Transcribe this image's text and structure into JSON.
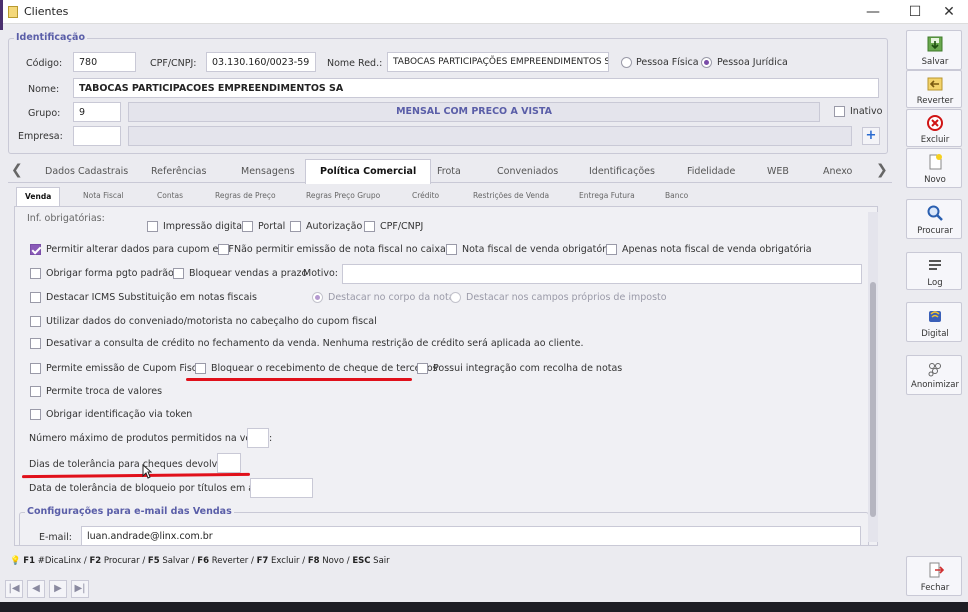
{
  "window": {
    "title": "Clientes",
    "minimize": "—",
    "maximize": "☐",
    "close": "✕"
  },
  "identificacao": {
    "title": "Identificação",
    "codigo_label": "Código:",
    "codigo": "780",
    "cpf_label": "CPF/CNPJ:",
    "cpf": "03.130.160/0023-59",
    "nome_red_label": "Nome Red.:",
    "nome_red": "TABOCAS PARTICIPAÇÕES EMPREENDIMENTOS S/A",
    "pessoa_fisica": "Pessoa Física",
    "pessoa_juridica": "Pessoa Jurídica",
    "nome_label": "Nome:",
    "nome": "TABOCAS PARTICIPACOES EMPREENDIMENTOS SA",
    "grupo_label": "Grupo:",
    "grupo": "9",
    "grupo_desc": "MENSAL COM PRECO A VISTA",
    "inativo": "Inativo",
    "empresa_label": "Empresa:",
    "empresa": "",
    "add": "+"
  },
  "tabs": [
    "Dados Cadastrais",
    "Referências",
    "Mensagens",
    "Política Comercial",
    "Frota",
    "Conveniados",
    "Identificações",
    "Fidelidade",
    "WEB",
    "Anexo"
  ],
  "tab_arrows": {
    "left": "❮",
    "right": "❯"
  },
  "subtabs": [
    "Venda",
    "Nota Fiscal",
    "Contas",
    "Regras de Preço",
    "Regras Preço Grupo",
    "Crédito",
    "Restrições de Venda",
    "Entrega Futura",
    "Banco"
  ],
  "venda": {
    "inf_obrigatorias": "Inf. obrigatórias:",
    "impressao_digital": "Impressão digital",
    "portal": "Portal",
    "autorizacao": "Autorização",
    "cpf_cnpj": "CPF/CNPJ",
    "permitir_alterar": "Permitir alterar dados para cupom e NF",
    "nao_permitir_emissao": "Não permitir emissão de nota fiscal no caixa",
    "nota_fiscal_obrigatoria": "Nota fiscal de venda obrigatória",
    "apenas_nota_fiscal": "Apenas nota fiscal de venda obrigatória",
    "obrigar_forma_pgto": "Obrigar forma pgto padrão",
    "bloquear_vendas_prazo": "Bloquear vendas a prazo",
    "motivo_label": "Motivo:",
    "motivo": "",
    "destacar_icms": "Destacar ICMS Substituição em notas fiscais",
    "destacar_corpo": "Destacar no corpo da nota",
    "destacar_campos": "Destacar nos campos próprios de imposto",
    "utilizar_dados": "Utilizar dados do conveniado/motorista no cabeçalho do cupom fiscal",
    "desativar_consulta": "Desativar a consulta de crédito no fechamento da venda. Nenhuma restrição de crédito será aplicada ao cliente.",
    "permite_emissao_cupom": "Permite emissão de Cupom Fiscal",
    "bloquear_cheque": "Bloquear o recebimento de cheque de terceiros",
    "possui_integracao": "Possui integração com recolha de notas",
    "permite_troca": "Permite troca de valores",
    "obrigar_identificacao": "Obrigar identificação via token",
    "numero_maximo_label": "Número máximo de produtos permitidos na venda:",
    "numero_maximo": "",
    "dias_tolerancia_label": "Dias de tolerância para cheques devolvidos:",
    "dias_tolerancia": "",
    "data_tolerancia_label": "Data de tolerância de bloqueio por títulos em atraso:",
    "data_tolerancia": "",
    "config_email_title": "Configurações para e-mail das Vendas",
    "email_label": "E-mail:",
    "email": "luan.andrade@linx.com.br"
  },
  "toolbar": {
    "salvar": "Salvar",
    "reverter": "Reverter",
    "excluir": "Excluir",
    "novo": "Novo",
    "procurar": "Procurar",
    "log": "Log",
    "digital": "Digital",
    "anonimizar": "Anonimizar",
    "fechar": "Fechar"
  },
  "shortcuts": {
    "f1": "F1",
    "f1_txt": " #DicaLinx / ",
    "f2": "F2",
    "f2_txt": " Procurar / ",
    "f5": "F5",
    "f5_txt": " Salvar / ",
    "f6": "F6",
    "f6_txt": " Reverter / ",
    "f7": "F7",
    "f7_txt": " Excluir / ",
    "f8": "F8",
    "f8_txt": " Novo / ",
    "esc": "ESC",
    "esc_txt": " Sair"
  },
  "nav": {
    "first": "|◀",
    "prev": "◀",
    "next": "▶",
    "last": "▶|"
  },
  "colors": {
    "accent": "#7a4da8",
    "group_title": "#5a5ea8",
    "annotation": "#e0101a"
  }
}
